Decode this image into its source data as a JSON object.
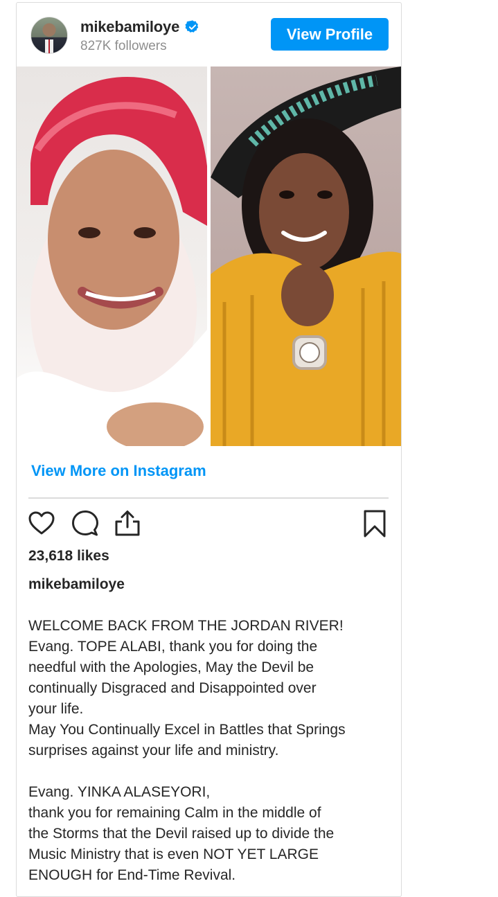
{
  "header": {
    "username": "mikebamiloye",
    "followers": "827K followers",
    "view_profile_label": "View Profile",
    "verified_icon": "verified-badge-icon",
    "brand_color": "#0095f6"
  },
  "post": {
    "view_more_label": "View More on Instagram",
    "likes": "23,618 likes",
    "caption_user": "mikebamiloye",
    "caption_lines": [
      "WELCOME BACK FROM THE JORDAN RIVER!",
      "Evang. TOPE ALABI, thank you for doing the",
      "needful with the Apologies, May the Devil be",
      "continually Disgraced and Disappointed over",
      "your life.",
      "May You Continually Excel in Battles that Springs",
      "surprises against your life and ministry.",
      "",
      "Evang. YINKA ALASEYORI,",
      "thank you for remaining Calm in the middle of",
      "the Storms that the Devil raised up to divide the",
      "Music Ministry that is even NOT YET LARGE",
      "ENOUGH for End-Time Revival."
    ]
  },
  "icons": {
    "like": "heart-icon",
    "comment": "comment-icon",
    "share": "share-icon",
    "save": "bookmark-icon"
  }
}
